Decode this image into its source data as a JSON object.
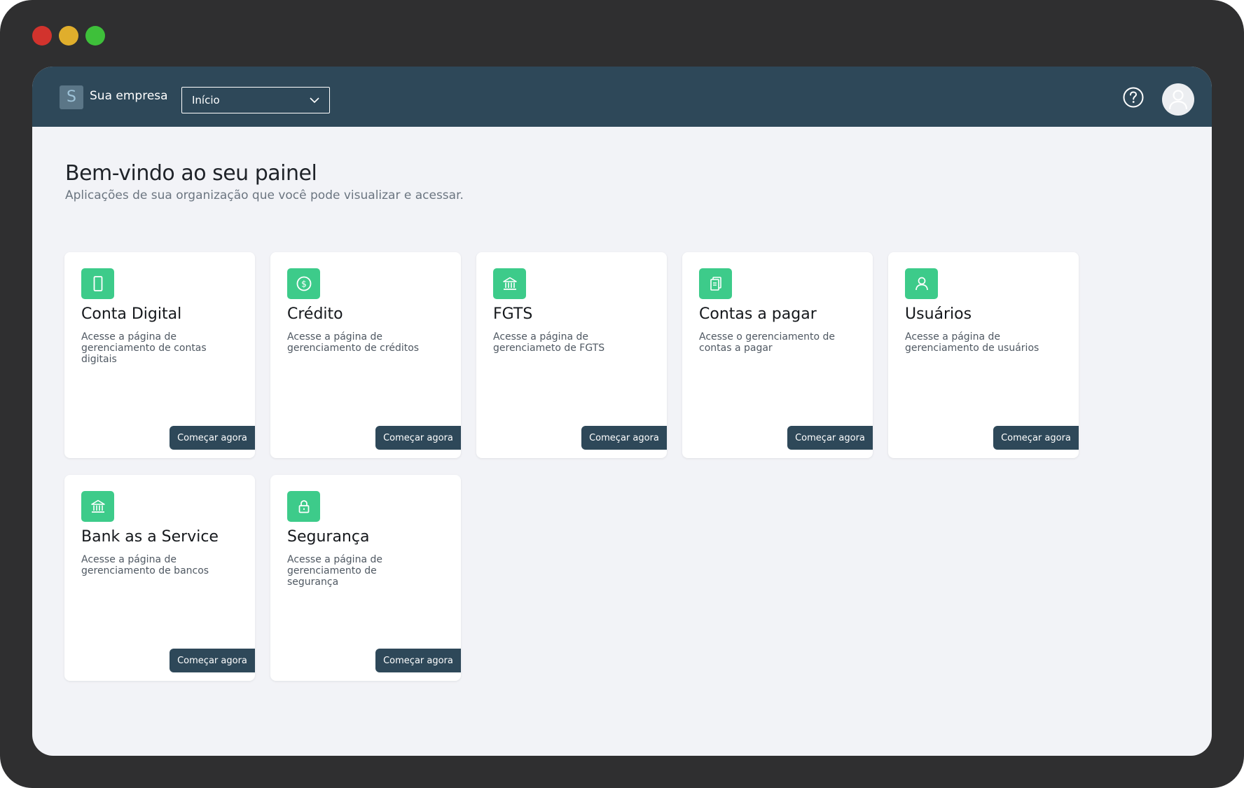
{
  "header": {
    "logo_letter": "S",
    "company_name": "Sua empresa",
    "nav_select_value": "Início"
  },
  "page": {
    "title": "Bem-vindo ao seu painel",
    "subtitle": "Aplicações de sua organização que você pode visualizar e acessar."
  },
  "cards": [
    {
      "title": "Conta Digital",
      "description": "Acesse a página de gerenciamento de contas digitais",
      "button": "Começar agora",
      "icon": "phone-icon"
    },
    {
      "title": "Crédito",
      "description": "Acesse a página de gerenciamento de créditos",
      "button": "Começar agora",
      "icon": "dollar-coin-icon"
    },
    {
      "title": "FGTS",
      "description": "Acesse a página de gerenciameto de FGTS",
      "button": "Começar agora",
      "icon": "bank-icon"
    },
    {
      "title": "Contas a pagar",
      "description": "Acesse o gerenciamento de contas a pagar",
      "button": "Começar agora",
      "icon": "clipboard-icon"
    },
    {
      "title": "Usuários",
      "description": "Acesse a página de gerenciamento de usuários",
      "button": "Começar agora",
      "icon": "user-icon"
    },
    {
      "title": "Bank as a Service",
      "description": "Acesse a página de gerenciamento de bancos",
      "button": "Começar agora",
      "icon": "bank-icon"
    },
    {
      "title": "Segurança",
      "description": "Acesse a página de gerenciamento de segurança",
      "button": "Começar agora",
      "icon": "lock-icon"
    }
  ],
  "colors": {
    "header_bg": "#2e4859",
    "accent_green": "#3dcb8a",
    "page_bg": "#f2f3f7"
  }
}
